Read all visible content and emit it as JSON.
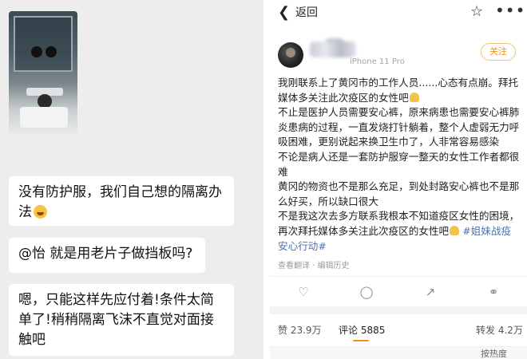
{
  "chat": {
    "messages": [
      {
        "text": "没有防护服，我们自己想的隔离办法"
      },
      {
        "text": "@怡 就是用老片子做挡板吗?"
      },
      {
        "text": "嗯，只能这样先应付着!条件太简单了!稍稍隔离飞沫不直觉对面接触吧"
      }
    ]
  },
  "weibo": {
    "back_label": "返回",
    "device": "iPhone 11 Pro",
    "follow_label": "关注",
    "post": {
      "lines": [
        "我刚联系上了黄冈市的工作人员......心态有点崩。拜托媒体多关注此次疫区的女性吧",
        "不止是医护人员需要安心裤，原来病患也需要安心裤肺炎患病的过程，一直发烧打针躺着，整个人虚弱无力呼吸困难，更别说起来换卫生巾了，人非常容易感染",
        "不论是病人还是一套防护服穿一整天的女性工作者都很难",
        "黄冈的物资也不是那么充足，到处封路安心裤也不是那么好买，所以缺口很大",
        "不是我这次去多方联系我根本不知道疫区女性的困境，再次拜托媒体多关注此次疫区的女性吧"
      ],
      "hashtag": "#姐妹战疫安心行动#"
    },
    "meta": "查看翻译 · 编辑历史",
    "stats": {
      "likes": "赞 23.9万",
      "comments": "评论 5885",
      "reposts": "转发 4.2万"
    },
    "sort_label": "按热度"
  },
  "icons": {
    "back": "chevron-left-icon",
    "star": "star-icon",
    "more": "more-icon",
    "like": "thumbs-up-icon",
    "comment": "comment-icon",
    "share": "share-icon",
    "repost": "repost-icon"
  }
}
